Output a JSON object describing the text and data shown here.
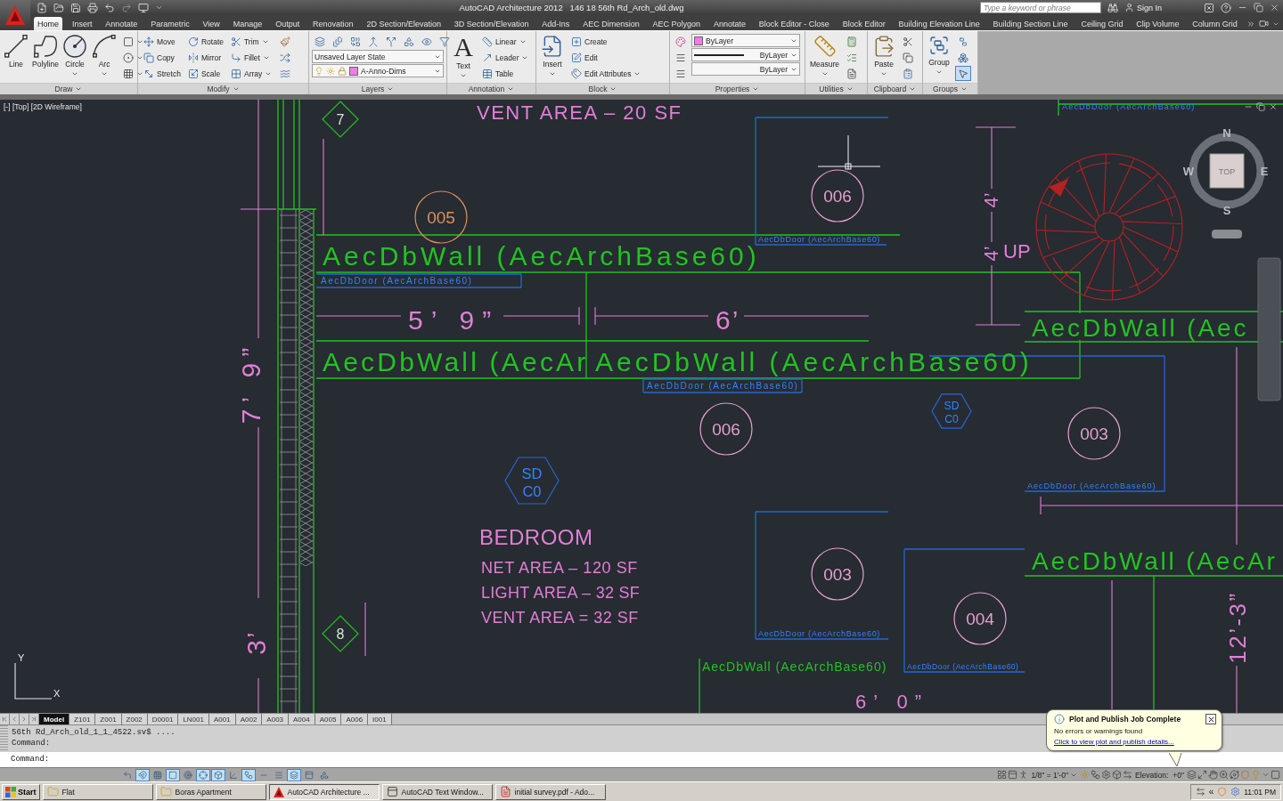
{
  "title_bar": {
    "title": "AutoCAD Architecture 2012   146 18 56th Rd_Arch_old.dwg",
    "search": {
      "placeholder": "Type a keyword or phrase"
    },
    "sign_in": "Sign In"
  },
  "ribbon_tabs": [
    {
      "label": "Home",
      "selected": true
    },
    {
      "label": "Insert",
      "selected": false
    },
    {
      "label": "Annotate",
      "selected": false
    },
    {
      "label": "Parametric",
      "selected": false
    },
    {
      "label": "View",
      "selected": false
    },
    {
      "label": "Manage",
      "selected": false
    },
    {
      "label": "Output",
      "selected": false
    },
    {
      "label": "Renovation",
      "selected": false
    },
    {
      "label": "2D Section/Elevation",
      "selected": false
    },
    {
      "label": "3D Section/Elevation",
      "selected": false
    },
    {
      "label": "Add-Ins",
      "selected": false
    },
    {
      "label": "AEC Dimension",
      "selected": false
    },
    {
      "label": "AEC Polygon",
      "selected": false
    },
    {
      "label": "Annotate",
      "selected": false
    },
    {
      "label": "Block Editor - Close",
      "selected": false
    },
    {
      "label": "Block Editor",
      "selected": false
    },
    {
      "label": "Building Elevation Line",
      "selected": false
    },
    {
      "label": "Building Section Line",
      "selected": false
    },
    {
      "label": "Ceiling Grid",
      "selected": false
    },
    {
      "label": "Clip Volume",
      "selected": false
    },
    {
      "label": "Column Grid",
      "selected": false
    }
  ],
  "ribbon": {
    "draw": {
      "title": "Draw",
      "tools": [
        "Line",
        "Polyline",
        "Circle",
        "Arc"
      ]
    },
    "modify": {
      "title": "Modify",
      "tools": [
        "Move",
        "Rotate",
        "Trim",
        "Copy",
        "Mirror",
        "Fillet",
        "Stretch",
        "Scale",
        "Array"
      ]
    },
    "layers": {
      "title": "Layers",
      "layer_state": "Unsaved Layer State",
      "current_layer": "A-Anno-Dims"
    },
    "annotation": {
      "title": "Annotation",
      "text_glyph": "A",
      "large_tool": "Text",
      "tools": [
        "Linear",
        "Leader",
        "Table"
      ]
    },
    "block": {
      "title": "Block",
      "large_tool": "Insert",
      "tools": [
        "Create",
        "Edit",
        "Edit Attributes"
      ]
    },
    "properties": {
      "title": "Properties",
      "color_setting": "ByLayer",
      "linetype": "ByLayer",
      "lineweight": "ByLayer"
    },
    "utilities": {
      "title": "Utilities",
      "large_tool": "Measure"
    },
    "clipboard": {
      "title": "Clipboard",
      "large_tool": "Paste"
    },
    "groups": {
      "title": "Groups",
      "large_tool": "Group",
      "selection_on": true
    }
  },
  "viewport": {
    "label": "[-] [Top] [2D Wireframe]",
    "view_cube": {
      "top": "TOP",
      "north": "N",
      "south": "S",
      "east": "E",
      "west": "W"
    },
    "ucs": {
      "y": "Y",
      "x": "X"
    }
  },
  "drawing": {
    "labels": [
      {
        "kind": "mark",
        "text": "7"
      },
      {
        "kind": "room",
        "text": "VENT AREA – 20 SF"
      },
      {
        "kind": "door",
        "text": "AecDbDoor (AecArchBase60)"
      },
      {
        "kind": "door_tag",
        "text": "005"
      },
      {
        "kind": "door_tag",
        "text": "006"
      },
      {
        "kind": "dimension",
        "text": "4’"
      },
      {
        "kind": "door",
        "text": "AecDbDoor (AecArchBase60)"
      },
      {
        "kind": "wall",
        "text": "AecDbWall (AecArchBase60)"
      },
      {
        "kind": "dimension",
        "text": "4’"
      },
      {
        "kind": "room",
        "text": "UP"
      },
      {
        "kind": "door",
        "text": "AecDbDoor (AecArchBase60)"
      },
      {
        "kind": "dimension",
        "text": "5’ 9”"
      },
      {
        "kind": "dimension",
        "text": "6’"
      },
      {
        "kind": "wall",
        "text": "AecDbWall (Aec"
      },
      {
        "kind": "dimension",
        "text": "7’ 9”"
      },
      {
        "kind": "wall",
        "text": "AecDbWall (AecAr"
      },
      {
        "kind": "wall",
        "text": "AecDbWall (AecArchBase60)"
      },
      {
        "kind": "door",
        "text": "AecDbDoor (AecArchBase60)"
      },
      {
        "kind": "door_tag",
        "text": "006"
      },
      {
        "kind": "section_tag",
        "text": "SD",
        "sub": "C0"
      },
      {
        "kind": "door_tag",
        "text": "003"
      },
      {
        "kind": "section_tag",
        "text": "SD",
        "sub": "C0"
      },
      {
        "kind": "door",
        "text": "AecDbDoor (AecArchBase60)"
      },
      {
        "kind": "room",
        "text": "BEDROOM"
      },
      {
        "kind": "room",
        "text": "NET AREA – 120 SF"
      },
      {
        "kind": "door_tag",
        "text": "003"
      },
      {
        "kind": "wall",
        "text": "AecDbWall (AecAr"
      },
      {
        "kind": "room",
        "text": "LIGHT AREA – 32 SF"
      },
      {
        "kind": "room",
        "text": "VENT AREA = 32 SF"
      },
      {
        "kind": "door_tag",
        "text": "004"
      },
      {
        "kind": "dimension",
        "text": "3’"
      },
      {
        "kind": "mark",
        "text": "8"
      },
      {
        "kind": "door",
        "text": "AecDbDoor (AecArchBase60)"
      },
      {
        "kind": "dimension",
        "text": "12’-3”"
      },
      {
        "kind": "wall",
        "text": "AecDbWall (AecArchBase60)"
      },
      {
        "kind": "door",
        "text": "AecDbDoor (AecArchBase60)"
      },
      {
        "kind": "dimension",
        "text": "6’ 0”"
      }
    ]
  },
  "layout_tabs": [
    {
      "label": "Model",
      "selected": true
    },
    {
      "label": "Z101",
      "selected": false
    },
    {
      "label": "Z001",
      "selected": false
    },
    {
      "label": "Z002",
      "selected": false
    },
    {
      "label": "D0001",
      "selected": false
    },
    {
      "label": "LN001",
      "selected": false
    },
    {
      "label": "A001",
      "selected": false
    },
    {
      "label": "A002",
      "selected": false
    },
    {
      "label": "A003",
      "selected": false
    },
    {
      "label": "A004",
      "selected": false
    },
    {
      "label": "A005",
      "selected": false
    },
    {
      "label": "A006",
      "selected": false
    },
    {
      "label": "I001",
      "selected": false
    }
  ],
  "command_line": {
    "history": [
      "56th Rd_Arch_old_1_1_4522.sv$ ....",
      "Command:"
    ],
    "prompt": "Command:"
  },
  "status_bar": {
    "toggles": [
      {
        "on": false
      },
      {
        "on": true
      },
      {
        "on": false
      },
      {
        "on": true
      },
      {
        "on": false
      },
      {
        "on": true
      },
      {
        "on": true
      },
      {
        "on": false
      },
      {
        "on": true
      },
      {
        "on": false
      },
      {
        "on": false
      },
      {
        "on": true
      },
      {
        "on": false
      },
      {
        "on": false
      }
    ],
    "annotation_scale": "1/8\" = 1'-0\"",
    "elevation_label": "Elevation:",
    "elevation": "+0\""
  },
  "notification": {
    "title": "Plot and Publish Job Complete",
    "message": "No errors or warnings found",
    "link": "Click to view plot and publish details..."
  },
  "taskbar": {
    "start": "Start",
    "buttons": [
      {
        "label": "Flat",
        "selected": false
      },
      {
        "label": "Boras Apartment",
        "selected": false
      },
      {
        "label": "AutoCAD Architecture ...",
        "selected": true
      },
      {
        "label": "AutoCAD Text Window...",
        "selected": false
      },
      {
        "label": "initial survey.pdf - Ado...",
        "selected": false
      }
    ],
    "tray_expand": "«",
    "clock": "11:01 PM"
  }
}
